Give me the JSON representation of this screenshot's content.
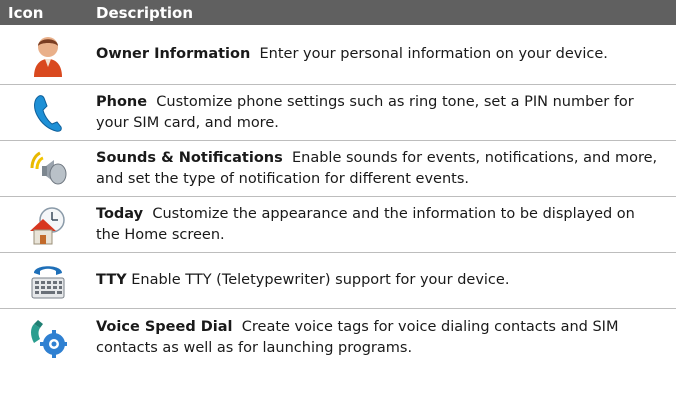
{
  "header": {
    "icon": "Icon",
    "description": "Description"
  },
  "rows": [
    {
      "icon": "owner-information-icon",
      "title": "Owner Information",
      "text": "Enter your personal information on your device."
    },
    {
      "icon": "phone-icon",
      "title": "Phone",
      "text": "Customize phone settings such as ring tone, set a PIN number for your SIM card, and more."
    },
    {
      "icon": "sounds-notifications-icon",
      "title": "Sounds & Notifications",
      "text": "Enable sounds for events, notifications, and more, and set the type of notification for different events."
    },
    {
      "icon": "today-icon",
      "title": "Today",
      "text": "Customize the appearance and the information to be displayed on the Home screen."
    },
    {
      "icon": "tty-icon",
      "title": "TTY",
      "text": "Enable TTY (Teletypewriter) support for your device."
    },
    {
      "icon": "voice-speed-dial-icon",
      "title": "Voice Speed Dial",
      "text": "Create voice tags for voice dialing contacts and SIM contacts as well as for launching programs."
    }
  ]
}
